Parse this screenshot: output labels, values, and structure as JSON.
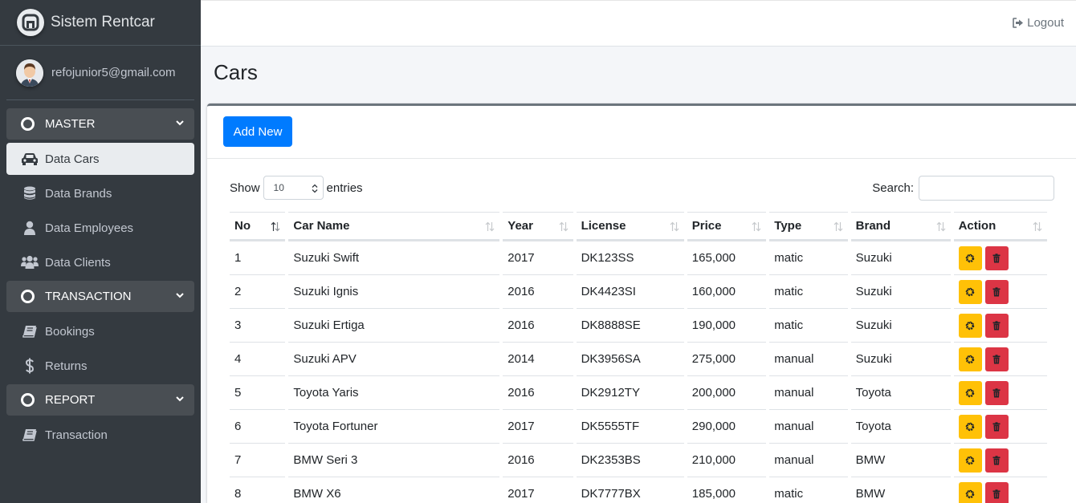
{
  "app": {
    "title": "Sistem Rentcar"
  },
  "user": {
    "email": "refojunior5@gmail.com"
  },
  "nav": {
    "sections": [
      {
        "label": "MASTER",
        "items": [
          "Data Cars",
          "Data Brands",
          "Data Employees",
          "Data Clients"
        ]
      },
      {
        "label": "TRANSACTION",
        "items": [
          "Bookings",
          "Returns"
        ]
      },
      {
        "label": "REPORT",
        "items": [
          "Transaction"
        ]
      }
    ],
    "active": "Data Cars"
  },
  "topbar": {
    "logout": "Logout"
  },
  "page": {
    "title": "Cars",
    "add_button": "Add New"
  },
  "table_controls": {
    "show_label": "Show",
    "entries_value": "10",
    "entries_label": "entries",
    "search_label": "Search:"
  },
  "table": {
    "columns": [
      "No",
      "Car Name",
      "Year",
      "License",
      "Price",
      "Type",
      "Brand",
      "Action"
    ],
    "rows": [
      [
        "1",
        "Suzuki Swift",
        "2017",
        "DK123SS",
        "165,000",
        "matic",
        "Suzuki"
      ],
      [
        "2",
        "Suzuki Ignis",
        "2016",
        "DK4423SI",
        "160,000",
        "matic",
        "Suzuki"
      ],
      [
        "3",
        "Suzuki Ertiga",
        "2016",
        "DK8888SE",
        "190,000",
        "matic",
        "Suzuki"
      ],
      [
        "4",
        "Suzuki APV",
        "2014",
        "DK3956SA",
        "275,000",
        "manual",
        "Suzuki"
      ],
      [
        "5",
        "Toyota Yaris",
        "2016",
        "DK2912TY",
        "200,000",
        "manual",
        "Toyota"
      ],
      [
        "6",
        "Toyota Fortuner",
        "2017",
        "DK5555TF",
        "290,000",
        "manual",
        "Toyota"
      ],
      [
        "7",
        "BMW Seri 3",
        "2016",
        "DK2353BS",
        "210,000",
        "manual",
        "BMW"
      ],
      [
        "8",
        "BMW X6",
        "2017",
        "DK7777BX",
        "185,000",
        "matic",
        "BMW"
      ]
    ]
  },
  "colors": {
    "sidebar": "#343a40",
    "primary": "#007bff",
    "warning": "#ffc107",
    "danger": "#dc3545"
  }
}
